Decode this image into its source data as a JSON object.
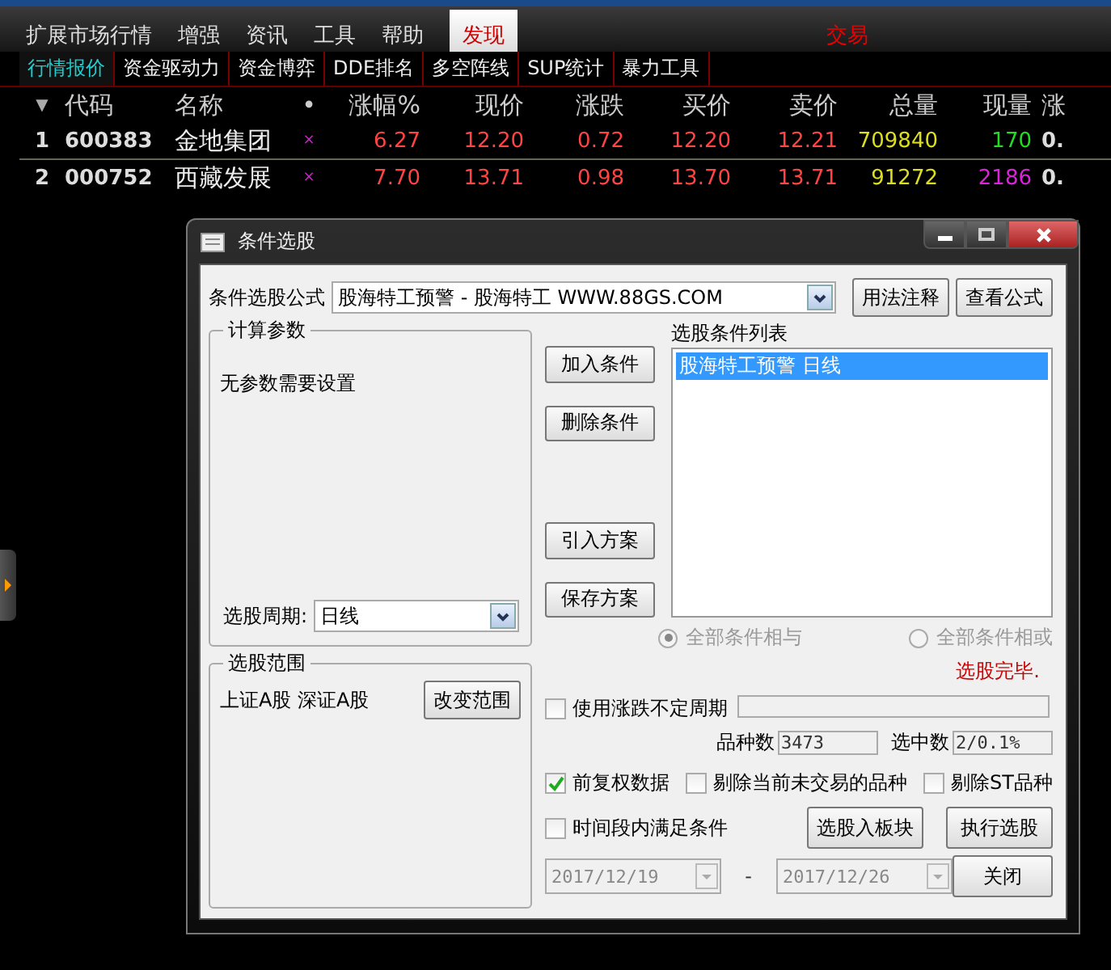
{
  "menu": {
    "items": [
      {
        "label": "扩展市场行情",
        "selected": false
      },
      {
        "label": "增强",
        "selected": false
      },
      {
        "label": "资讯",
        "selected": false
      },
      {
        "label": "工具",
        "selected": false
      },
      {
        "label": "帮助",
        "selected": false
      },
      {
        "label": "发现",
        "selected": true
      }
    ],
    "trailing_text": "交易"
  },
  "tabs": [
    {
      "label": "行情报价",
      "selected": true
    },
    {
      "label": "资金驱动力",
      "selected": false
    },
    {
      "label": "资金博弈",
      "selected": false
    },
    {
      "label": "DDE排名",
      "selected": false
    },
    {
      "label": "多空阵线",
      "selected": false
    },
    {
      "label": "SUP统计",
      "selected": false
    },
    {
      "label": "暴力工具",
      "selected": false
    }
  ],
  "table": {
    "sort_mark": "▼",
    "columns": [
      "代码",
      "名称",
      "•",
      "涨幅%",
      "现价",
      "涨跌",
      "买价",
      "卖价",
      "总量",
      "现量",
      "涨"
    ],
    "rows": [
      {
        "index": "1",
        "code": "600383",
        "name": "金地集团",
        "mark": "×",
        "change_pct": "6.27",
        "price": "12.20",
        "change": "0.72",
        "bid": "12.20",
        "ask": "12.21",
        "volume": "709840",
        "last_volume": {
          "text": "170",
          "color": "#22dd22"
        },
        "column_12": "0."
      },
      {
        "index": "2",
        "code": "000752",
        "name": "西藏发展",
        "mark": "×",
        "change_pct": "7.70",
        "price": "13.71",
        "change": "0.98",
        "bid": "13.70",
        "ask": "13.71",
        "volume": "91272",
        "last_volume": {
          "text": "2186",
          "color": "#dd22dd"
        },
        "column_12": "0."
      }
    ]
  },
  "dialog": {
    "title": "条件选股",
    "formula_label": "条件选股公式",
    "formula_value": "股海特工预警 - 股海特工 WWW.88GS.COM",
    "top_buttons": [
      "用法注释",
      "查看公式"
    ],
    "params_group": {
      "title": "计算参数",
      "text": "无参数需要设置",
      "period_label": "选股周期:",
      "period_value": "日线"
    },
    "middle_buttons": [
      "加入条件",
      "删除条件",
      "引入方案",
      "保存方案"
    ],
    "condition_list": {
      "title": "选股条件列表",
      "items": [
        {
          "text": "股海特工预警  日线",
          "selected": true
        }
      ]
    },
    "logic": [
      {
        "label": "全部条件相与",
        "selected": true,
        "disabled": true
      },
      {
        "label": "全部条件相或",
        "selected": false,
        "disabled": true
      }
    ],
    "status": "选股完毕.",
    "range_group": {
      "title": "选股范围",
      "text": "上证A股 深证A股",
      "button": "改变范围"
    },
    "variable_period": {
      "label": "使用涨跌不定周期",
      "checked": false
    },
    "counts": [
      {
        "label": "品种数",
        "value": "3473"
      },
      {
        "label": "选中数",
        "value": "2/0.1%"
      }
    ],
    "options": [
      {
        "label": "前复权数据",
        "checked": true
      },
      {
        "label": "剔除当前未交易的品种",
        "checked": false
      },
      {
        "label": "剔除ST品种",
        "checked": false
      }
    ],
    "time_range": {
      "label": "时间段内满足条件",
      "checked": false,
      "start": "2017/12/19",
      "separator": "-",
      "end": "2017/12/26",
      "disabled": true
    },
    "bottom_buttons": [
      "选股入板块",
      "执行选股",
      "关闭"
    ]
  }
}
